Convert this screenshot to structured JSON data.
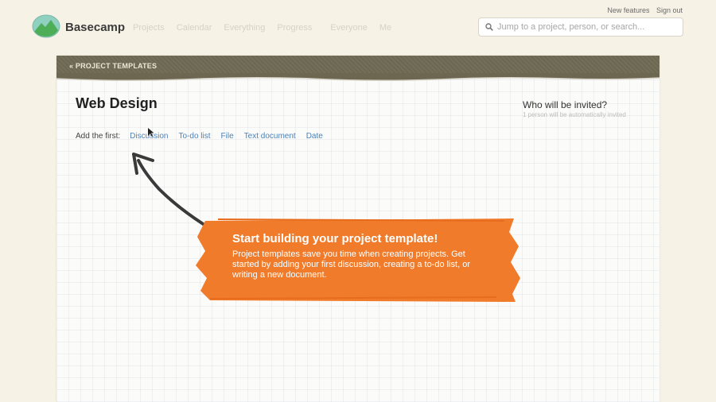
{
  "brand": "Basecamp",
  "nav": [
    "Projects",
    "Calendar",
    "Everything",
    "Progress",
    "Everyone",
    "Me"
  ],
  "toplinks": {
    "new_features": "New features",
    "sign_out": "Sign out"
  },
  "search": {
    "placeholder": "Jump to a project, person, or search..."
  },
  "header": {
    "label": "« PROJECT TEMPLATES"
  },
  "template": {
    "title": "Web Design",
    "invite_title": "Who will be invited?",
    "invite_sub": "1 person will be automatically invited"
  },
  "add_first": {
    "label": "Add the first:",
    "items": [
      "Discussion",
      "To-do list",
      "File",
      "Text document",
      "Date"
    ]
  },
  "callout": {
    "title": "Start building your project template!",
    "body": "Project templates save you time when creating projects. Get started by adding your first discussion, creating a to-do list, or writing a new document."
  },
  "colors": {
    "accent": "#f07b2a",
    "header": "#6d6752",
    "link": "#4f82b5"
  }
}
